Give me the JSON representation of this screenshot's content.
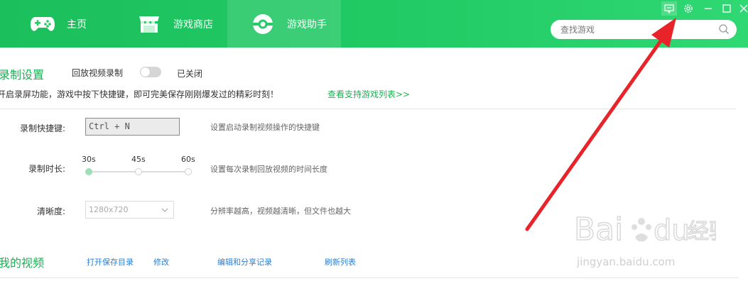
{
  "nav": {
    "tabs": [
      {
        "label": "主页",
        "icon": "gamepad-icon"
      },
      {
        "label": "游戏商店",
        "icon": "store-icon"
      },
      {
        "label": "游戏助手",
        "icon": "disc-icon",
        "active": true
      }
    ]
  },
  "search": {
    "placeholder": "查找游戏"
  },
  "window_controls": [
    "feedback-icon",
    "settings-icon",
    "minimize-icon",
    "maximize-icon",
    "close-icon"
  ],
  "record": {
    "title": "录制设置",
    "replay_label": "回放视频录制",
    "toggle_state": "已关闭",
    "toggle_on": false,
    "description": "开启录屏功能，游戏中按下快捷键，即可完美保存刚刚爆发过的精彩时刻！",
    "supported_link": "查看支持游戏列表>>",
    "hotkey": {
      "label": "录制快捷键:",
      "value": "Ctrl + N",
      "hint": "设置启动录制视频操作的快捷键"
    },
    "duration": {
      "label": "录制时长:",
      "options": [
        "30s",
        "45s",
        "60s"
      ],
      "selected": "30s",
      "hint": "设置每次录制回放视频的时间长度"
    },
    "quality": {
      "label": "清晰度:",
      "value": "1280x720",
      "hint": "分辨率越高，视频越清晰，但文件也越大"
    }
  },
  "videos": {
    "title": "我的视频",
    "actions": [
      "打开保存目录",
      "修改",
      "编辑和分享记录",
      "刷新列表"
    ]
  },
  "watermark": {
    "brand": "Baidu经验",
    "url": "jingyan.baidu.com"
  },
  "colors": {
    "accent": "#1fae56",
    "header": "#23cc66",
    "link": "#2a7fd4",
    "annotation_arrow": "#e8232a"
  }
}
